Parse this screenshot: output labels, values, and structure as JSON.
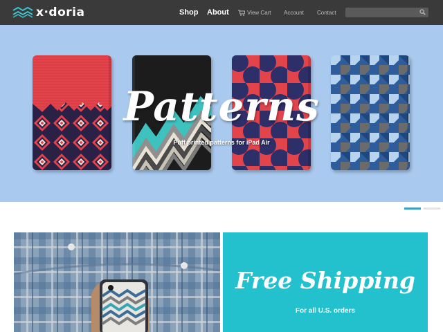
{
  "header": {
    "logo_text": "x·doria",
    "nav": {
      "shop": "Shop",
      "about": "About",
      "view_cart": "View Cart",
      "account": "Account",
      "contact": "Contact"
    },
    "search": {
      "placeholder": "",
      "icon": "search-icon"
    }
  },
  "hero": {
    "title": "Patterns",
    "subtitle": "Puff printed patterns for iPad Air",
    "slides": {
      "count": 2,
      "active_index": 0
    }
  },
  "promo": {
    "title": "Free Shipping",
    "subtitle": "For all U.S. orders"
  },
  "colors": {
    "header_bg": "#3a3a3a",
    "logo_accent": "#3ec2cf",
    "hero_bg": "#a9c9ee",
    "promo_bg": "#22c1cd",
    "slider_active": "#3aa0c5"
  }
}
